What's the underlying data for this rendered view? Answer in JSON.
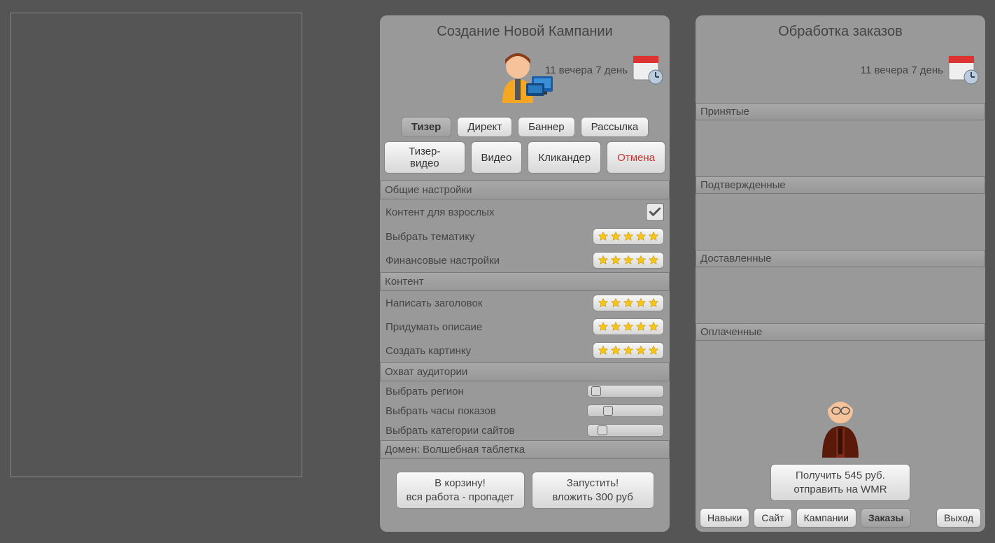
{
  "datetime": "11 вечера 7 день",
  "main": {
    "title": "Создание Новой Кампании",
    "tabs_row1": [
      "Тизер",
      "Директ",
      "Баннер",
      "Рассылка"
    ],
    "tabs_row2": [
      "Тизер-видео",
      "Видео",
      "Кликандер",
      "Отмена"
    ],
    "active_tab": "Тизер",
    "cancel_tab": "Отмена",
    "sections": {
      "general": {
        "header": "Общие настройки",
        "rows": [
          {
            "label": "Контент для взрослых",
            "widget": "check",
            "checked": true
          },
          {
            "label": "Выбрать тематику",
            "widget": "stars"
          },
          {
            "label": "Финансовые настройки",
            "widget": "stars"
          }
        ]
      },
      "content": {
        "header": "Контент",
        "rows": [
          {
            "label": "Написать заголовок",
            "widget": "stars"
          },
          {
            "label": "Придумать описаие",
            "widget": "stars"
          },
          {
            "label": "Создать картинку",
            "widget": "stars"
          }
        ]
      },
      "coverage": {
        "header": "Охват аудитории",
        "rows": [
          {
            "label": "Выбрать регион",
            "widget": "slider",
            "pos": 5
          },
          {
            "label": "Выбрать часы показов",
            "widget": "slider",
            "pos": 22
          },
          {
            "label": "Выбрать категории сайтов",
            "widget": "slider",
            "pos": 14
          }
        ]
      },
      "domain": {
        "header": "Домен: Волшебная таблетка"
      }
    },
    "discard": {
      "line1": "В корзину!",
      "line2": "вся работа - пропадет"
    },
    "launch": {
      "line1": "Запустить!",
      "line2": "вложить 300 руб"
    }
  },
  "orders": {
    "title": "Обработка заказов",
    "sections": [
      "Принятые",
      "Подтвержденные",
      "Доставленные",
      "Оплаченные"
    ],
    "payout": {
      "line1": "Получить 545 руб.",
      "line2": "отправить на WMR"
    }
  },
  "nav": [
    "Навыки",
    "Сайт",
    "Кампании",
    "Заказы",
    "Выход"
  ],
  "nav_active": "Заказы"
}
